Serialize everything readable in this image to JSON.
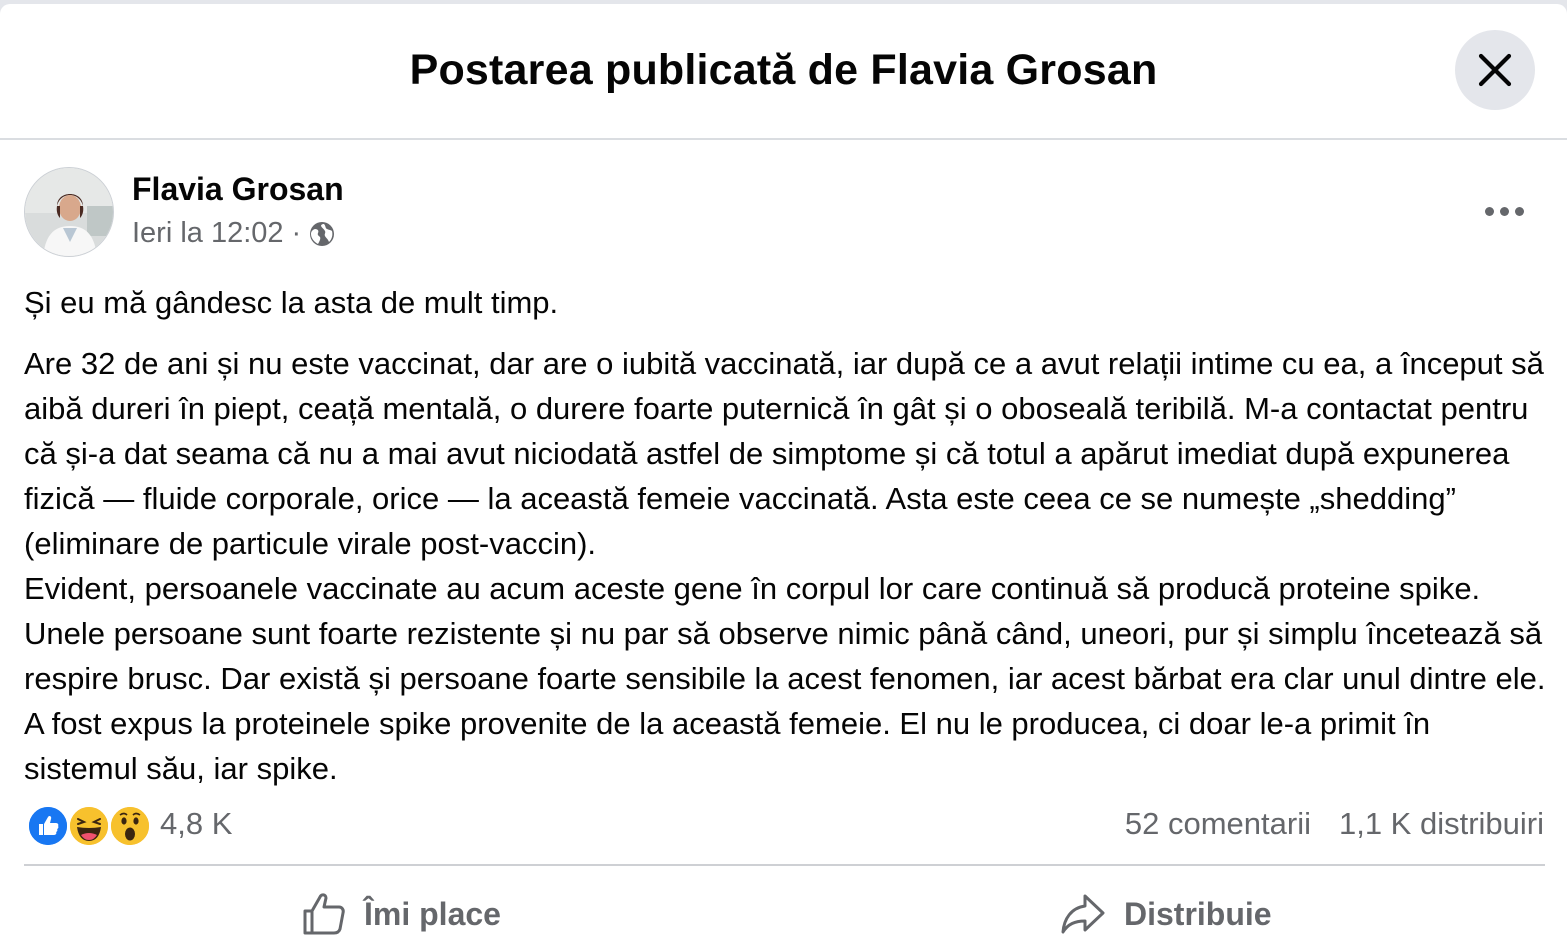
{
  "dialog": {
    "title": "Postarea publicată de Flavia Grosan",
    "close_icon": "close-icon"
  },
  "post": {
    "author": "Flavia Grosan",
    "timestamp": "Ieri la 12:02",
    "separator": "·",
    "audience_icon": "globe-icon",
    "more_icon": "more-horizontal-icon",
    "paragraphs": [
      "Și eu mă gândesc la asta de mult timp.",
      "Are 32 de ani și nu este vaccinat, dar are o iubită vaccinată, iar după ce a avut relații intime cu ea, a început să aibă dureri în piept, ceață mentală, o durere foarte puternică în gât și o oboseală teribilă. M-a contactat pentru că și-a dat seama că nu a mai avut niciodată astfel de simptome și că totul a apărut imediat după expunerea fizică — fluide corporale, orice — la această femeie vaccinată. Asta este ceea ce se numește „shedding” (eliminare de particule virale post-vaccin).",
      "Evident, persoanele vaccinate au acum aceste gene în corpul lor care continuă să producă proteine spike. Unele persoane sunt foarte rezistente și nu par să observe nimic până când, uneori, pur și simplu încetează să respire brusc. Dar există și persoane foarte sensibile la acest fenomen, iar acest bărbat era clar unul dintre ele. A fost expus la proteinele spike provenite de la această femeie. El nu le producea, ci doar le-a primit în sistemul său, iar spike."
    ]
  },
  "stats": {
    "reaction_icons": [
      "like-icon",
      "haha-icon",
      "wow-icon"
    ],
    "reaction_count": "4,8 K",
    "comments": "52 comentarii",
    "shares": "1,1 K distribuiri"
  },
  "actions": {
    "like_label": "Îmi place",
    "like_icon": "thumbs-up-icon",
    "share_label": "Distribuie",
    "share_icon": "share-arrow-icon"
  },
  "colors": {
    "accent_blue": "#1877f2",
    "secondary_text": "#65676b",
    "divider": "#ced0d4"
  }
}
